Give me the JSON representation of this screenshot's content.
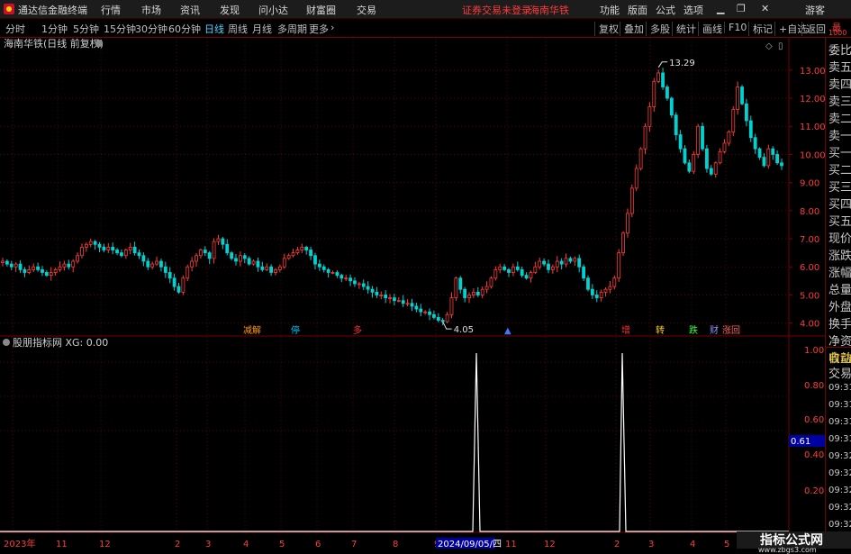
{
  "app": {
    "title": "通达信金融终端",
    "menus": [
      "行情",
      "市场",
      "资讯",
      "发现",
      "问小达",
      "财富圈",
      "交易"
    ],
    "broker_status": "证券交易未登录",
    "stock_name": "海南华铁",
    "right_menus": [
      "功能",
      "版面",
      "公式",
      "选项"
    ],
    "guest": "游客",
    "window_controls": [
      "▁",
      "❐",
      "✕"
    ]
  },
  "toolbar": {
    "periods": [
      "分时",
      "1分钟",
      "5分钟",
      "15分钟",
      "30分钟",
      "60分钟",
      "日线",
      "周线",
      "月线",
      "多周期",
      "更多"
    ],
    "selected": "日线",
    "more_arrow": "›",
    "buttons": [
      "复权",
      "叠加",
      "多股",
      "统计",
      "画线",
      "F10",
      "标记",
      "+自选",
      "返回"
    ]
  },
  "main_chart": {
    "header": "海南华铁(日线 前复权)",
    "high_label": "13.29",
    "low_label": "4.05",
    "events": [
      {
        "label": "减解",
        "color": "#ff9900"
      },
      {
        "label": "停",
        "color": "#00c8ff"
      },
      {
        "label": "多",
        "color": "#ff3030"
      },
      {
        "label": "▲",
        "color": "#3c78ff"
      },
      {
        "label": "增",
        "color": "#ff3030"
      },
      {
        "label": "转",
        "color": "#ffd200"
      },
      {
        "label": "跌",
        "color": "#33ff33"
      },
      {
        "label": "财",
        "color": "#9090ff"
      },
      {
        "label": "涨回",
        "color": "#ff6060"
      }
    ],
    "y_ticks": [
      "13.00",
      "12.00",
      "11.00",
      "10.00",
      "9.00",
      "8.00",
      "7.00",
      "6.00",
      "5.00",
      "4.00"
    ]
  },
  "indicator": {
    "header": "股朋指标网 XG: 0.00",
    "y_ticks": [
      "1.00",
      "0.80",
      "0.61",
      "0.60",
      "0.40",
      "0.20"
    ],
    "cursor_value": "0.61"
  },
  "x_axis": {
    "labels": [
      "2023年",
      "11",
      "12",
      "2",
      "3",
      "4",
      "5",
      "6",
      "7",
      "8",
      "9",
      "11",
      "12",
      "2",
      "3",
      "4",
      "5"
    ],
    "cursor_date": "2024/09/05/四"
  },
  "right_panel": {
    "label_top": "委比",
    "items": [
      "卖五",
      "卖四",
      "卖三",
      "卖二",
      "卖一",
      "买一",
      "买二",
      "买三",
      "买四",
      "买五",
      "现价",
      "涨跌",
      "涨幅",
      "总量",
      "外盘",
      "换手",
      "净资",
      "收益"
    ],
    "auto_trade": [
      "自动",
      "交易"
    ],
    "times": [
      "09:31",
      "09:31",
      "09:31",
      "09:31",
      "09:32",
      "09:32",
      "09:32",
      "09:32",
      "09:32"
    ],
    "corner_text": "最",
    "corner_value": "1000"
  },
  "watermark": {
    "title": "指标公式网",
    "url": "www.zbgs3.com"
  },
  "colors": {
    "up": "#ff3c3c",
    "down": "#00d2d2",
    "signal": "#ffffff",
    "border": "#7a0000",
    "highlight": "#0000a0"
  },
  "chart_data": {
    "type": "candlestick",
    "price_range": [
      3.7,
      13.7
    ],
    "y_ticks": [
      4,
      5,
      6,
      7,
      8,
      9,
      10,
      11,
      12,
      13
    ],
    "close": [
      6.2,
      6.1,
      6.0,
      6.1,
      5.9,
      5.8,
      5.9,
      6.0,
      5.9,
      5.8,
      5.7,
      5.8,
      5.9,
      6.0,
      6.1,
      6.0,
      6.2,
      6.4,
      6.7,
      6.8,
      6.9,
      6.8,
      6.7,
      6.6,
      6.7,
      6.6,
      6.5,
      6.4,
      6.6,
      6.7,
      6.5,
      6.4,
      6.2,
      6.0,
      6.1,
      6.2,
      6.0,
      5.8,
      5.6,
      5.3,
      5.1,
      5.6,
      6.0,
      6.2,
      6.4,
      6.6,
      6.5,
      6.3,
      6.9,
      7.0,
      6.8,
      6.5,
      6.3,
      6.2,
      6.4,
      6.3,
      6.1,
      6.2,
      6.0,
      5.9,
      6.0,
      5.8,
      5.9,
      6.0,
      6.3,
      6.4,
      6.5,
      6.6,
      6.7,
      6.6,
      6.4,
      6.1,
      6.0,
      5.9,
      5.8,
      5.8,
      5.7,
      5.6,
      5.6,
      5.5,
      5.4,
      5.4,
      5.3,
      5.2,
      5.1,
      5.0,
      5.0,
      4.9,
      4.9,
      4.8,
      4.8,
      4.7,
      4.7,
      4.6,
      4.5,
      4.4,
      4.4,
      4.3,
      4.2,
      4.1,
      4.05,
      4.3,
      4.9,
      5.6,
      5.2,
      4.9,
      5.0,
      5.1,
      5.0,
      5.2,
      5.3,
      5.6,
      5.9,
      6.0,
      5.9,
      5.8,
      6.0,
      5.9,
      5.7,
      5.6,
      5.8,
      6.0,
      6.2,
      6.1,
      5.9,
      6.0,
      6.2,
      6.1,
      6.3,
      6.2,
      6.3,
      6.0,
      5.6,
      5.2,
      5.0,
      4.9,
      5.1,
      5.2,
      5.3,
      5.6,
      6.5,
      7.2,
      7.9,
      8.8,
      9.5,
      10.2,
      11.0,
      11.7,
      12.6,
      12.9,
      12.4,
      12.0,
      11.4,
      10.7,
      10.2,
      9.7,
      9.4,
      10.0,
      11.0,
      10.2,
      9.5,
      9.3,
      9.7,
      10.1,
      10.4,
      10.8,
      11.6,
      12.4,
      11.8,
      11.2,
      10.6,
      10.2,
      9.9,
      9.6,
      10.2,
      10.0,
      9.7,
      9.6
    ]
  }
}
